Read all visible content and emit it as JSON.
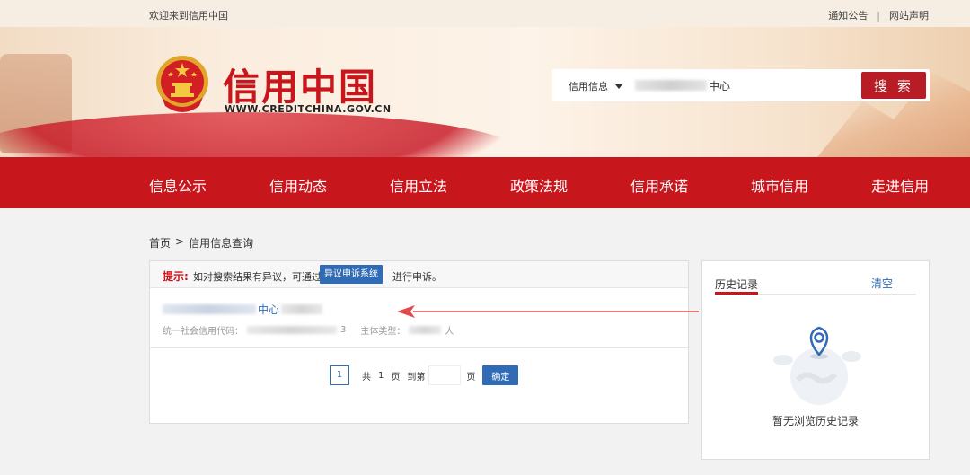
{
  "topbar": {
    "welcome": "欢迎来到信用中国",
    "notice": "通知公告",
    "separator": "|",
    "statement": "网站声明"
  },
  "header": {
    "logo_title": "信用中国",
    "logo_url": "WWW.CREDITCHINA.GOV.CN",
    "search": {
      "type_label": "信用信息",
      "query_visible": "中心",
      "button_label": "搜 索"
    }
  },
  "nav": {
    "items": [
      {
        "label": "信息公示"
      },
      {
        "label": "信用动态"
      },
      {
        "label": "信用立法"
      },
      {
        "label": "政策法规"
      },
      {
        "label": "信用承诺"
      },
      {
        "label": "城市信用"
      },
      {
        "label": "走进信用"
      }
    ]
  },
  "breadcrumb": {
    "home": "首页",
    "sep": ">",
    "current": "信用信息查询"
  },
  "tip": {
    "label": "提示:",
    "text": "如对搜索结果有异议，可通过",
    "button": "异议申诉系统",
    "after": "进行申诉。"
  },
  "result": {
    "company_visible": "中心",
    "code_label": "统一社会信用代码：",
    "code_tail": "3",
    "type_label": "主体类型：",
    "type_tail": "人"
  },
  "pager": {
    "current": "1",
    "total_prefix": "共",
    "total": "1",
    "total_suffix": "页",
    "goto": "到第",
    "page_suffix": "页",
    "confirm": "确定"
  },
  "history": {
    "title": "历史记录",
    "clear": "清空",
    "empty": "暂无浏览历史记录"
  },
  "colors": {
    "brand_red": "#c8161d",
    "link_blue": "#2f6cb5",
    "annotation_arrow": "#e04a4a"
  }
}
